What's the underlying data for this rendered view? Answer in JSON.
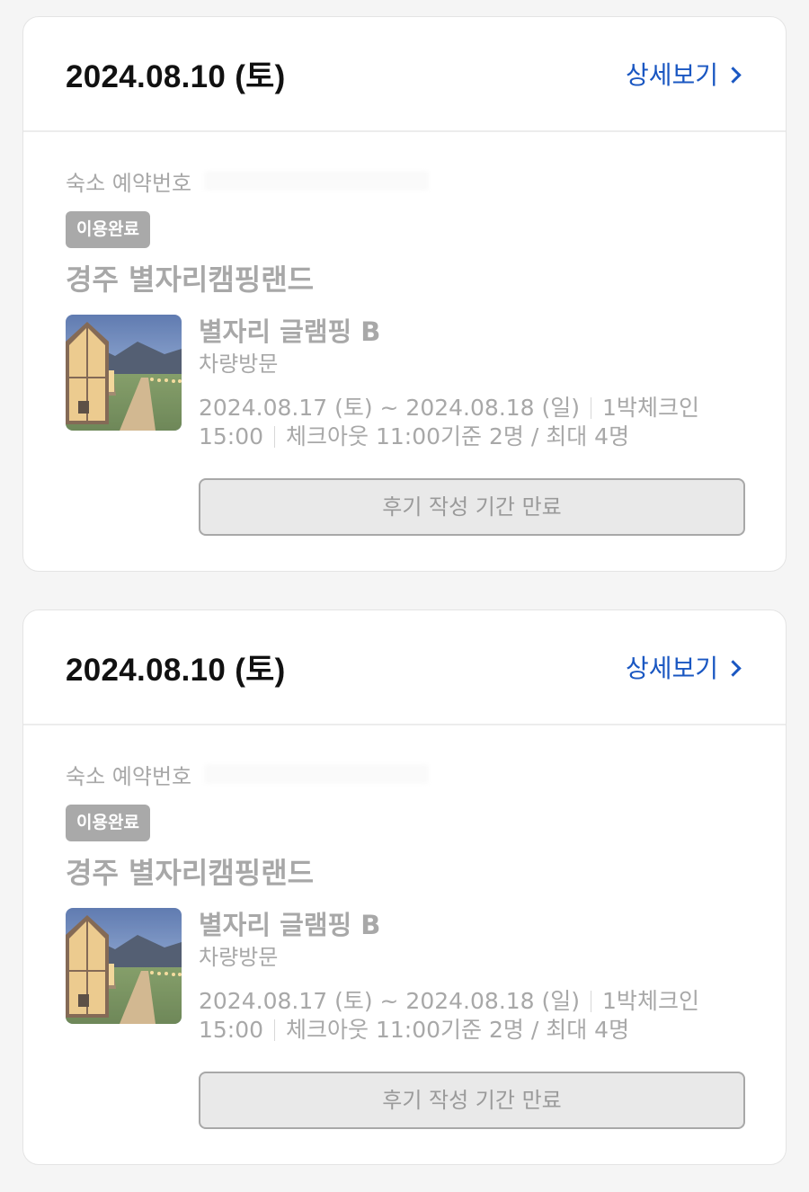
{
  "reservations": [
    {
      "date": "2024.08.10 (토)",
      "detail_label": "상세보기",
      "reservation_label": "숙소 예약번호",
      "status": "이용완료",
      "property_name": "경주 별자리캠핑랜드",
      "room_name": "별자리 글램핑 B",
      "visit_type": "차량방문",
      "period": "2024.08.17 (토) ~ 2024.08.18 (일)",
      "nights": "1박",
      "checkin": "체크인 15:00",
      "checkout": "체크아웃 11:00",
      "capacity": "기준 2명 / 최대 4명",
      "review_button": "후기 작성 기간 만료"
    },
    {
      "date": "2024.08.10 (토)",
      "detail_label": "상세보기",
      "reservation_label": "숙소 예약번호",
      "status": "이용완료",
      "property_name": "경주 별자리캠핑랜드",
      "room_name": "별자리 글램핑 B",
      "visit_type": "차량방문",
      "period": "2024.08.17 (토) ~ 2024.08.18 (일)",
      "nights": "1박",
      "checkin": "체크인 15:00",
      "checkout": "체크아웃 11:00",
      "capacity": "기준 2명 / 최대 4명",
      "review_button": "후기 작성 기간 만료"
    }
  ],
  "icons": {
    "detail": "chevron-right-icon"
  },
  "colors": {
    "link": "#1a57c2",
    "badge": "#a9a9a9",
    "muted_text": "#a8a8a8"
  }
}
